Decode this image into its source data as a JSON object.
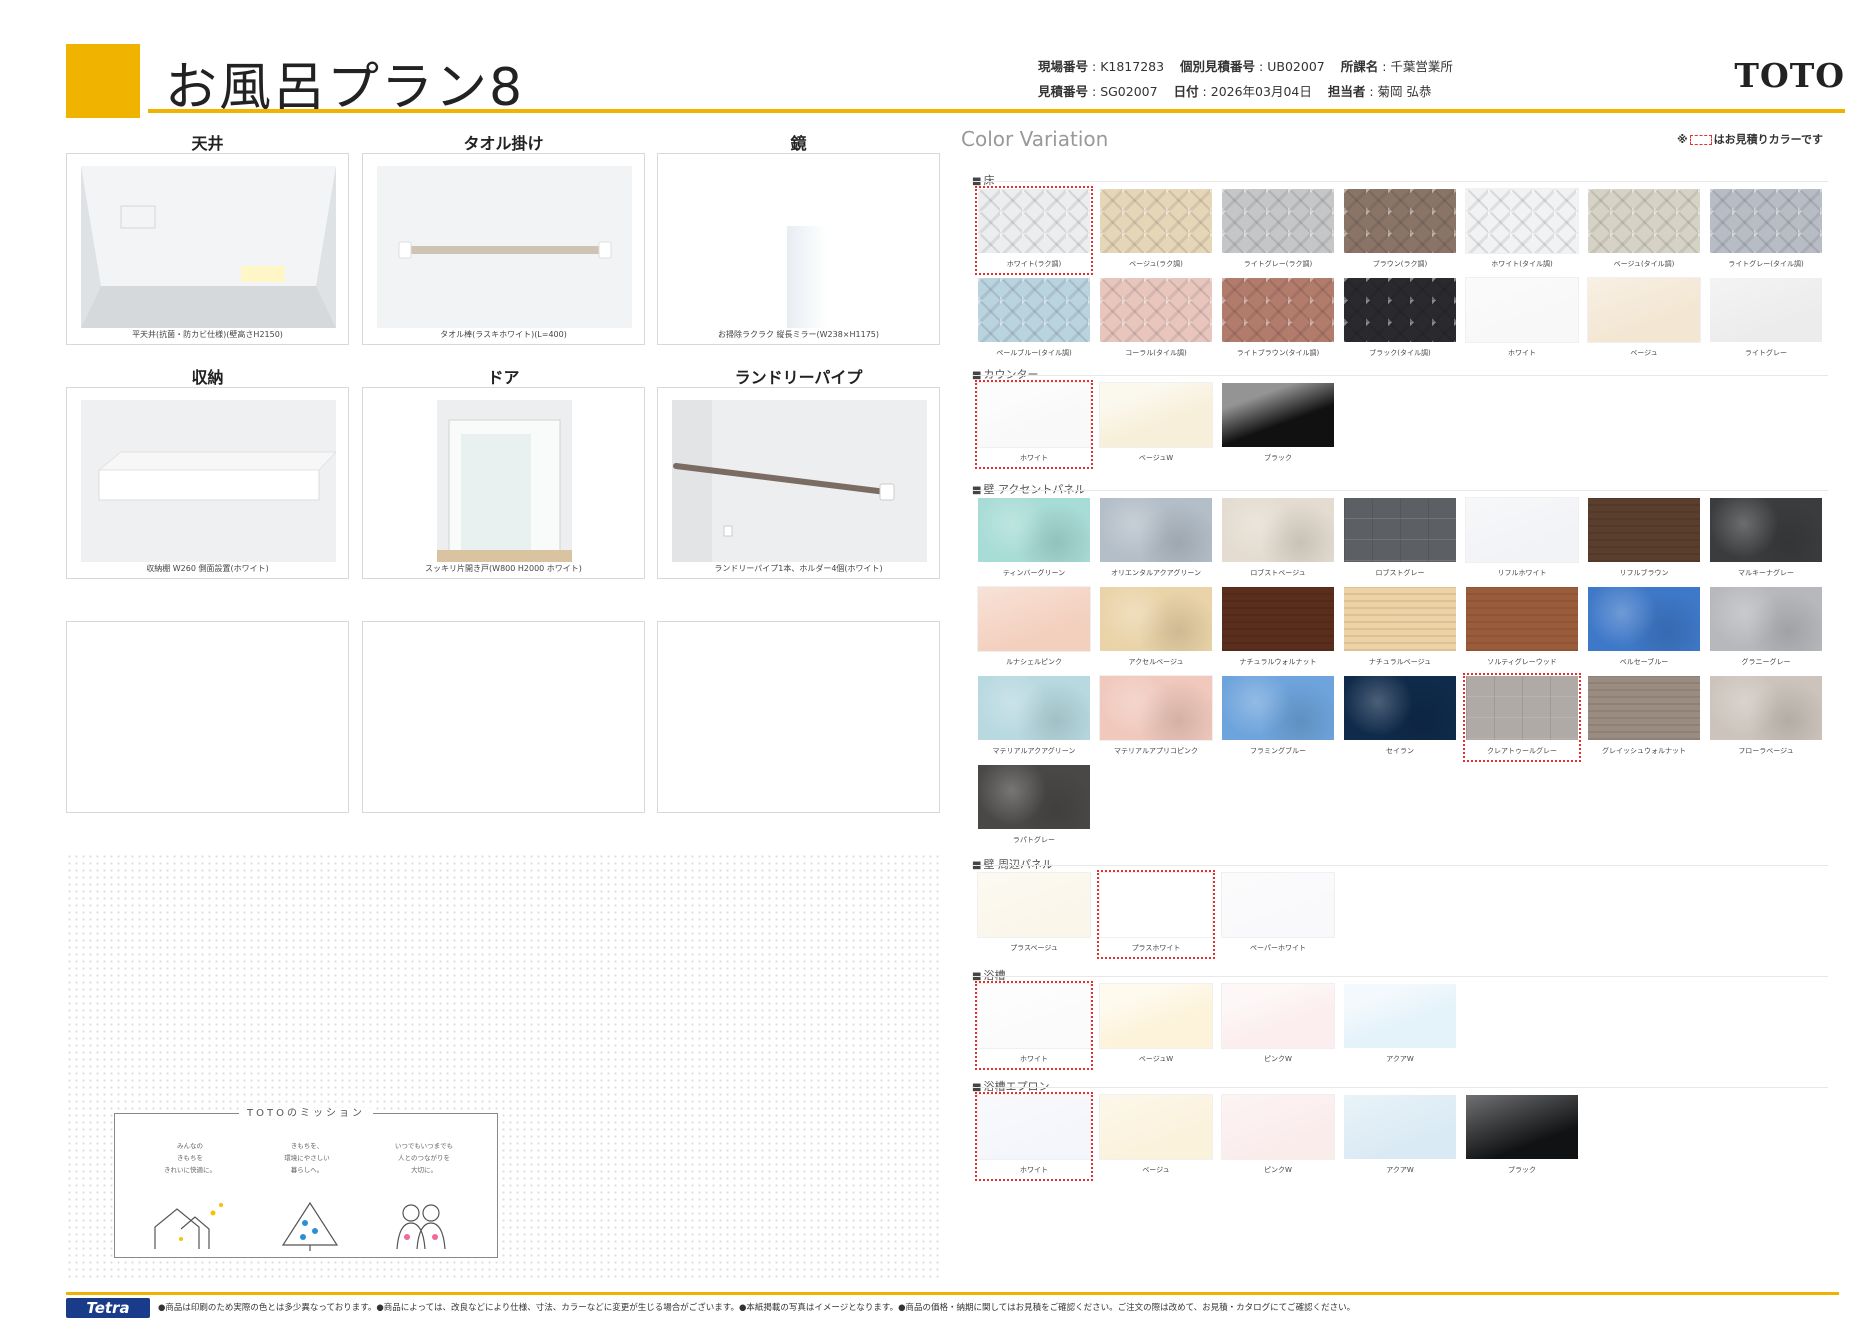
{
  "header": {
    "title": "お風呂プラン8",
    "site_no_label": "現場番号",
    "site_no": "K1817283",
    "estimate_id_label": "個別見積番号",
    "estimate_id": "UB02007",
    "office_label": "所課名",
    "office": "千葉営業所",
    "quote_no_label": "見積番号",
    "quote_no": "SG02007",
    "date_label": "日付",
    "date": "2026年03月04日",
    "person_label": "担当者",
    "person": "菊岡 弘恭",
    "brand": "TOTO"
  },
  "products": [
    {
      "title": "天井",
      "caption": "平天井(抗菌・防カビ仕様)(壁高さH2150)"
    },
    {
      "title": "タオル掛け",
      "caption": "タオル棒(ラスキホワイト)(L=400)"
    },
    {
      "title": "鏡",
      "caption": "お掃除ラクラク 縦長ミラー(W238×H1175)"
    },
    {
      "title": "収納",
      "caption": "収納棚 W260 側面設置(ホワイト)"
    },
    {
      "title": "ドア",
      "caption": "スッキリ片開き戸(W800 H2000 ホワイト)"
    },
    {
      "title": "ランドリーパイプ",
      "caption": "ランドリーパイプ1本、ホルダー4個(ホワイト)"
    }
  ],
  "mission": {
    "title": "TOTOのミッション",
    "cols": [
      "みんなの\nきもちを\nきれいに快適に。",
      "きもちを、\n環境にやさしい\n暮らしへ。",
      "いつでもいつまでも\n人とのつながりを\n大切に。"
    ]
  },
  "color_variation": {
    "title": "Color Variation",
    "note_prefix": "※",
    "note_suffix": "はお見積りカラーです",
    "categories": [
      {
        "label": "床",
        "items": [
          {
            "name": "ホワイト(ラク調)",
            "color": "#ecedef",
            "pattern": "tile",
            "selected": true
          },
          {
            "name": "ベージュ(ラク調)",
            "color": "#e6d6b8",
            "pattern": "tile"
          },
          {
            "name": "ライトグレー(ラク調)",
            "color": "#c4c6c8",
            "pattern": "tile"
          },
          {
            "name": "ブラウン(ラク調)",
            "color": "#8a7468",
            "pattern": "tile"
          },
          {
            "name": "ホワイト(タイル調)",
            "color": "#f1f2f4",
            "pattern": "tile"
          },
          {
            "name": "ベージュ(タイル調)",
            "color": "#d6d2c6",
            "pattern": "tile"
          },
          {
            "name": "ライトグレー(タイル調)",
            "color": "#b8bcc4",
            "pattern": "tile"
          },
          {
            "name": "ペールブルー(タイル調)",
            "color": "#b9d3df",
            "pattern": "tile"
          },
          {
            "name": "コーラル(タイル調)",
            "color": "#e8c6bd",
            "pattern": "tile"
          },
          {
            "name": "ライトブラウン(タイル調)",
            "color": "#b27c6c",
            "pattern": "tile"
          },
          {
            "name": "ブラック(タイル調)",
            "color": "#2a2a2e",
            "pattern": "tile"
          },
          {
            "name": "ホワイト",
            "color": "#f8f8f8",
            "pattern": "soft"
          },
          {
            "name": "ベージュ",
            "color": "#f3e6d2",
            "pattern": "soft"
          },
          {
            "name": "ライトグレー",
            "color": "#ececec",
            "pattern": "soft"
          }
        ]
      },
      {
        "label": "カウンター",
        "items": [
          {
            "name": "ホワイト",
            "color": "#f9f9f9",
            "pattern": "gloss",
            "selected": true
          },
          {
            "name": "ベージュW",
            "color": "#f7efd9",
            "pattern": "gloss"
          },
          {
            "name": "ブラック",
            "color": "#111111",
            "pattern": "gloss"
          }
        ]
      },
      {
        "label": "壁 アクセントパネル",
        "items": [
          {
            "name": "ティンバーグリーン",
            "color": "#a8dcd6",
            "pattern": "stone"
          },
          {
            "name": "オリエンタルアクアグリーン",
            "color": "#b4bec8",
            "pattern": "stone"
          },
          {
            "name": "ロブストベージュ",
            "color": "#e4dcd0",
            "pattern": "stone"
          },
          {
            "name": "ロブストグレー",
            "color": "#5c6064",
            "pattern": "block"
          },
          {
            "name": "リフルホワイト",
            "color": "#f2f3f6",
            "pattern": "soft"
          },
          {
            "name": "リフルブラウン",
            "color": "#5a3e2e",
            "pattern": "wood"
          },
          {
            "name": "マルキーナグレー",
            "color": "#3a3c3e",
            "pattern": "stone"
          },
          {
            "name": "ルナシェルピンク",
            "color": "#f3cfbd",
            "pattern": "soft"
          },
          {
            "name": "アクセルベージュ",
            "color": "#ead3a8",
            "pattern": "stone"
          },
          {
            "name": "ナチュラルウォルナット",
            "color": "#5a2e1c",
            "pattern": "wood"
          },
          {
            "name": "ナチュラルベージュ",
            "color": "#ecd2a4",
            "pattern": "wood"
          },
          {
            "name": "ソルティグレーウッド",
            "color": "#9b5c3c",
            "pattern": "wood"
          },
          {
            "name": "ベルセーブルー",
            "color": "#3e78c8",
            "pattern": "stone"
          },
          {
            "name": "グラニーグレー",
            "color": "#b6b8bc",
            "pattern": "stone"
          },
          {
            "name": "マテリアルアクアグリーン",
            "color": "#b8d9e0",
            "pattern": "stone"
          },
          {
            "name": "マテリアルアプリコピンク",
            "color": "#f0c8bc",
            "pattern": "stone"
          },
          {
            "name": "フラミングブルー",
            "color": "#6ea4dc",
            "pattern": "stone"
          },
          {
            "name": "セイラン",
            "color": "#0f2a4a",
            "pattern": "stone"
          },
          {
            "name": "クレアトゥールグレー",
            "color": "#b0aaa6",
            "pattern": "block",
            "selected": true
          },
          {
            "name": "グレイッシュウォルナット",
            "color": "#9a8c80",
            "pattern": "wood"
          },
          {
            "name": "フローラベージュ",
            "color": "#ccc4bc",
            "pattern": "stone"
          },
          {
            "name": "ラパトグレー",
            "color": "#4a4846",
            "pattern": "stone"
          }
        ]
      },
      {
        "label": "壁 周辺パネル",
        "items": [
          {
            "name": "プラスベージュ",
            "color": "#faf6ea",
            "pattern": "soft"
          },
          {
            "name": "プラスホワイト",
            "color": "#ffffff",
            "pattern": "soft",
            "selected": true
          },
          {
            "name": "ペーパーホワイト",
            "color": "#f9f9fb",
            "pattern": "soft"
          }
        ]
      },
      {
        "label": "浴槽",
        "items": [
          {
            "name": "ホワイト",
            "color": "#fbfbfb",
            "pattern": "gloss",
            "selected": true
          },
          {
            "name": "ベージュW",
            "color": "#fdf3da",
            "pattern": "gloss"
          },
          {
            "name": "ピンクW",
            "color": "#fceeee",
            "pattern": "gloss"
          },
          {
            "name": "アクアW",
            "color": "#e4f2fa",
            "pattern": "gloss"
          }
        ]
      },
      {
        "label": "浴槽エプロン",
        "items": [
          {
            "name": "ホワイト",
            "color": "#f4f6fb",
            "pattern": "soft",
            "selected": true
          },
          {
            "name": "ベージュ",
            "color": "#fbf2dc",
            "pattern": "soft"
          },
          {
            "name": "ピンクW",
            "color": "#fbecec",
            "pattern": "soft"
          },
          {
            "name": "アクアW",
            "color": "#daeaf4",
            "pattern": "soft"
          },
          {
            "name": "ブラック",
            "color": "#111214",
            "pattern": "soft"
          }
        ]
      }
    ]
  },
  "footer": {
    "brand": "Tetra",
    "note": "●商品は印刷のため実際の色とは多少異なっております。●商品によっては、改良などにより仕様、寸法、カラーなどに変更が生じる場合がございます。●本紙掲載の写真はイメージとなります。●商品の価格・納期に関してはお見積をご確認ください。ご注文の際は改めて、お見積・カタログにてご確認ください。"
  }
}
